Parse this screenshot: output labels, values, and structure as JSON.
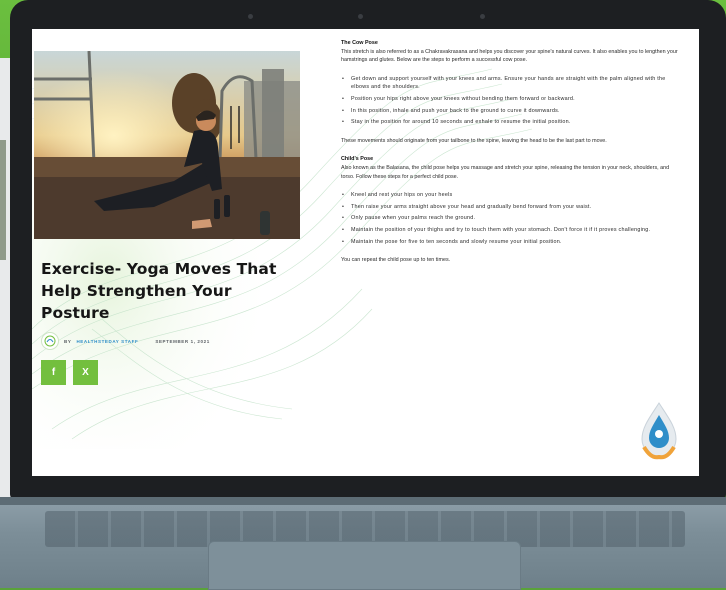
{
  "article": {
    "title": "Exercise- Yoga Moves That Help Strengthen Your Posture",
    "byline_prefix": "BY",
    "author": "HEALTHSTEDAY STAFF",
    "date": "SEPTEMBER 1, 2021",
    "share": {
      "facebook": "f",
      "x": "X"
    }
  },
  "content": {
    "cow_title": "The Cow Pose",
    "cow_intro": "This stretch is also referred to as a Chakravakrasana and helps you discover your spine's natural curves. It also enables you to lengthen your hamstrings and glutes. Below are the steps to perform a successful cow pose.",
    "cow_steps": [
      "Get down and support yourself with your knees and arms. Ensure your hands are straight with the palm aligned with the elbows and the shoulders.",
      "Position your hips right above your knees without bending them forward or backward.",
      "In this position, inhale and push your back to the ground to curve it downwards.",
      "Stay in the position for around 10 seconds and exhale to resume the initial position."
    ],
    "cow_outro": "These movements should originate from your tailbone to the spine, leaving the head to be the last part to move.",
    "child_title": "Child's Pose",
    "child_intro": "Also known as the Balasana, the child pose helps you massage and stretch your spine, releasing the tension in your neck, shoulders, and torso. Follow these steps for a perfect child pose.",
    "child_steps": [
      "Kneel and rest your hips on your heels",
      "Then raise your arms straight above your head and gradually bend forward from your waist.",
      "Only pause when your palms reach the ground.",
      "Maintain the position of your thighs and try to touch them with your stomach. Don't force it if it proves challenging.",
      "Maintain the pose for five to ten seconds and slowly resume your initial position."
    ],
    "child_outro": "You can repeat the child pose up to ten times."
  },
  "colors": {
    "accent_green": "#73bf3e",
    "author_blue": "#2f8ec9",
    "background_green": "#5aa33a"
  },
  "icons": [
    "facebook-icon",
    "x-icon",
    "site-logo-icon",
    "brand-drop-icon"
  ]
}
